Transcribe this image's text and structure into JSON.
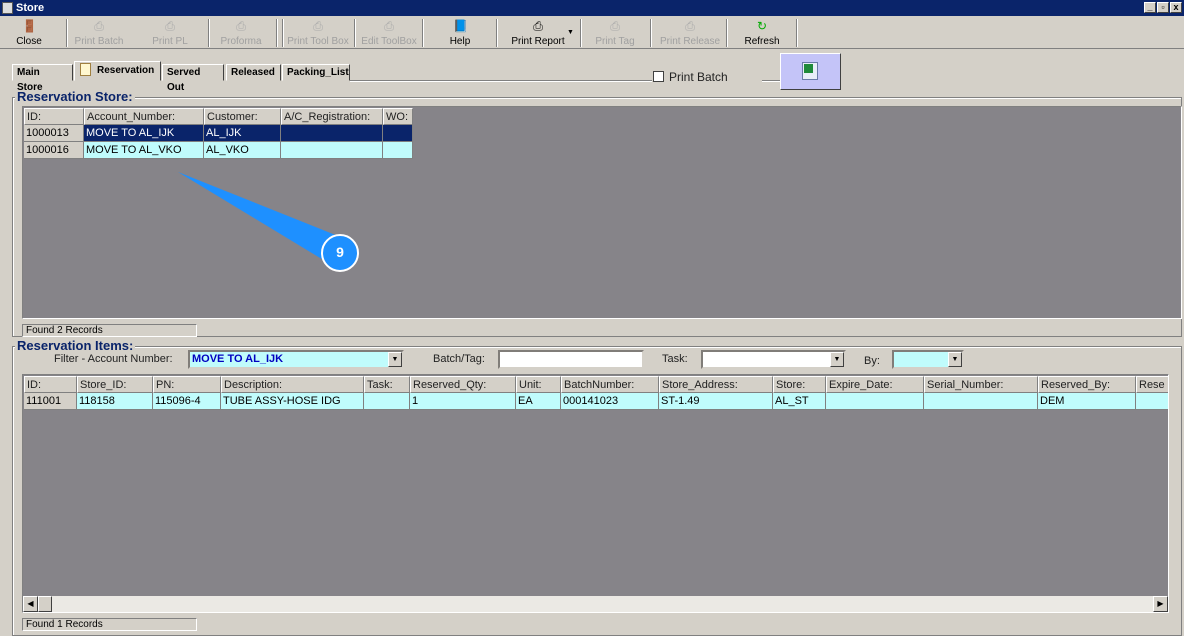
{
  "window": {
    "title": "Store"
  },
  "toolbar": [
    {
      "label": "Close",
      "icon": "door-exit-icon",
      "enabled": true
    },
    {
      "label": "Print Batch",
      "icon": "printer-icon",
      "enabled": false
    },
    {
      "label": "Print PL",
      "icon": "printer-icon",
      "enabled": false
    },
    {
      "label": "Proforma",
      "icon": "printer-icon",
      "enabled": false
    },
    {
      "label": "Print Tool Box",
      "icon": "printer-icon",
      "enabled": false
    },
    {
      "label": "Edit ToolBox",
      "icon": "printer-icon",
      "enabled": false
    },
    {
      "label": "Help",
      "icon": "help-book-icon",
      "enabled": true
    },
    {
      "label": "Print Report",
      "icon": "printer-icon",
      "enabled": true
    },
    {
      "label": "Print Tag",
      "icon": "printer-icon",
      "enabled": false
    },
    {
      "label": "Print Release",
      "icon": "printer-icon",
      "enabled": false
    },
    {
      "label": "Refresh",
      "icon": "refresh-icon",
      "enabled": true
    }
  ],
  "tabs": [
    {
      "label": "Main Store"
    },
    {
      "label": "Reservation",
      "active": true
    },
    {
      "label": "Served Out"
    },
    {
      "label": "Released"
    },
    {
      "label": "Packing_List"
    }
  ],
  "print_batch": {
    "label": "Print Batch",
    "checked": false
  },
  "excel_button": {
    "icon": "excel-export-icon"
  },
  "store": {
    "title": "Reservation Store:",
    "columns": [
      "ID:",
      "Account_Number:",
      "Customer:",
      "A/C_Registration:",
      "WO:"
    ],
    "rows": [
      [
        "1000013",
        "MOVE TO AL_IJK",
        "AL_IJK",
        "",
        ""
      ],
      [
        "1000016",
        "MOVE TO AL_VKO",
        "AL_VKO",
        "",
        ""
      ]
    ],
    "status": "Found 2 Records"
  },
  "callout": {
    "number": "9"
  },
  "items": {
    "title": "Reservation Items:",
    "filter_label": "Filter - Account Number:",
    "filter_value": "MOVE TO AL_IJK",
    "batch_label": "Batch/Tag:",
    "batch_value": "",
    "task_label": "Task:",
    "task_value": "",
    "by_label": "By:",
    "by_value": "",
    "columns": [
      "ID:",
      "Store_ID:",
      "PN:",
      "Description:",
      "Task:",
      "Reserved_Qty:",
      "Unit:",
      "BatchNumber:",
      "Store_Address:",
      "Store:",
      "Expire_Date:",
      "Serial_Number:",
      "Reserved_By:",
      "Rese"
    ],
    "rows": [
      [
        "111001",
        "118158",
        "115096-4",
        "TUBE ASSY-HOSE IDG",
        "",
        "1",
        "EA",
        "000141023",
        "ST-1.49",
        "AL_ST",
        "",
        "",
        "DEM",
        ""
      ]
    ],
    "status": "Found 1 Records"
  },
  "colors": {
    "title_bar": "#0a246a",
    "selected_row": "#0a246a",
    "row_bg": "#c0fcfc",
    "grid_bg": "#868489",
    "callout": "#1e90ff"
  }
}
